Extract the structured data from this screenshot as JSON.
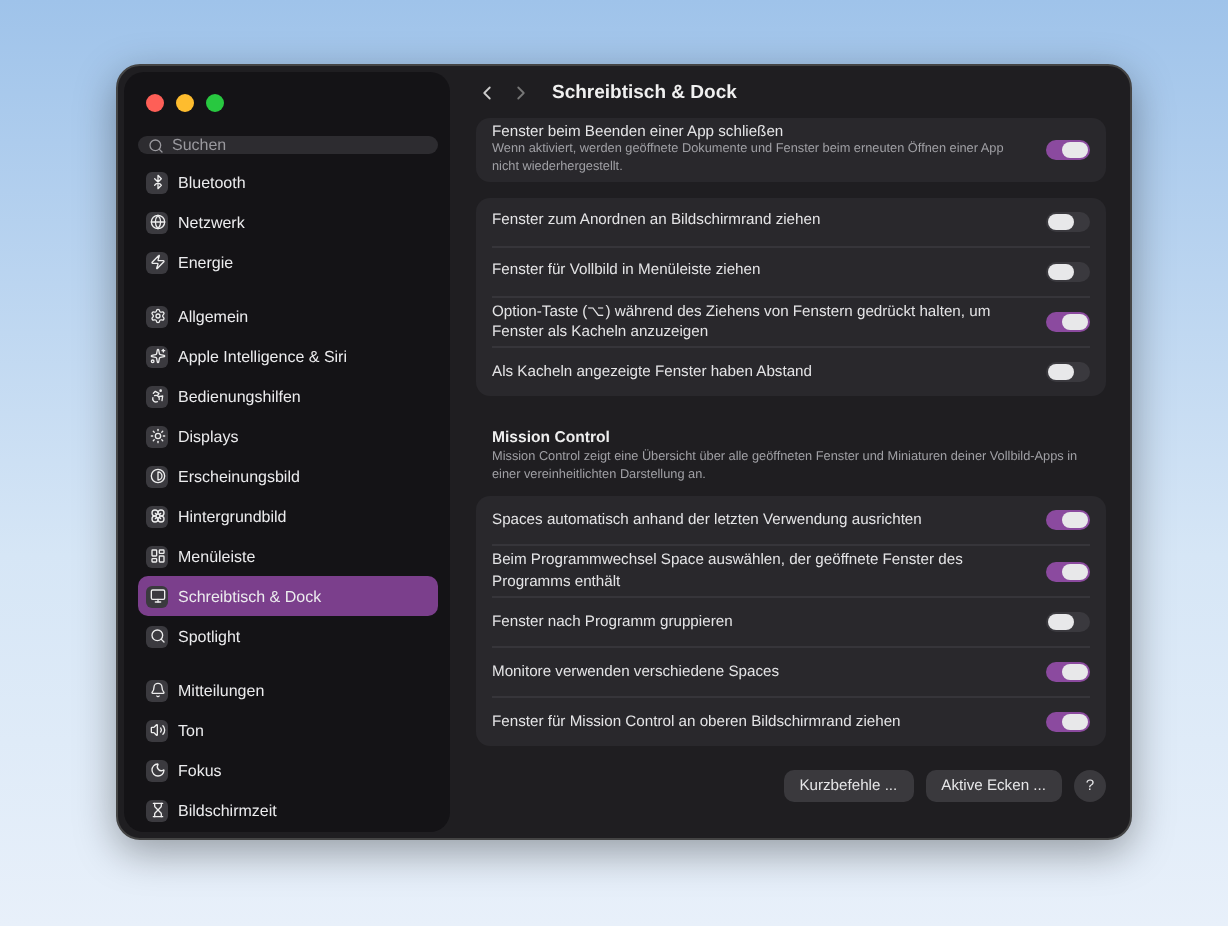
{
  "window": {
    "title": "Schreibtisch & Dock"
  },
  "sidebar": {
    "search": {
      "placeholder": "Suchen"
    },
    "groups": [
      [
        {
          "label": "Bluetooth",
          "selected": false
        },
        {
          "label": "Netzwerk",
          "selected": false
        },
        {
          "label": "Energie",
          "selected": false
        }
      ],
      [
        {
          "label": "Allgemein",
          "selected": false
        },
        {
          "label": "Apple Intelligence & Siri",
          "selected": false
        },
        {
          "label": "Bedienungshilfen",
          "selected": false
        },
        {
          "label": "Displays",
          "selected": false
        },
        {
          "label": "Erscheinungsbild",
          "selected": false
        },
        {
          "label": "Hintergrundbild",
          "selected": false
        },
        {
          "label": "Menüleiste",
          "selected": false
        },
        {
          "label": "Schreibtisch & Dock",
          "selected": true
        },
        {
          "label": "Spotlight",
          "selected": false
        }
      ],
      [
        {
          "label": "Mitteilungen",
          "selected": false
        },
        {
          "label": "Ton",
          "selected": false
        },
        {
          "label": "Fokus",
          "selected": false
        },
        {
          "label": "Bildschirmzeit",
          "selected": false
        }
      ]
    ]
  },
  "sections": [
    {
      "rows": [
        {
          "label": "Fenster beim Beenden einer App schließen",
          "description": "Wenn aktiviert, werden geöffnete Dokumente und Fenster beim erneuten Öffnen einer App nicht wiederhergestellt.",
          "on": true
        }
      ]
    },
    {
      "rows": [
        {
          "label": "Fenster zum Anordnen an Bildschirmrand ziehen",
          "on": false
        },
        {
          "label": "Fenster für Vollbild in Menüleiste ziehen",
          "on": false
        },
        {
          "label": "Option-Taste (⌥) während des Ziehens von Fenstern gedrückt halten, um Fenster als Kacheln anzuzeigen",
          "on": true
        },
        {
          "label": "Als Kacheln angezeigte Fenster haben Abstand",
          "on": false
        }
      ]
    },
    {
      "title": "Mission Control",
      "description": "Mission Control zeigt eine Übersicht über alle geöffneten Fenster und Miniaturen deiner Vollbild-Apps in einer vereinheitlichten Darstellung an.",
      "rows": [
        {
          "label": "Spaces automatisch anhand der letzten Verwendung ausrichten",
          "on": true
        },
        {
          "label": "Beim Programmwechsel Space auswählen, der geöffnete Fenster des Programms enthält",
          "on": true
        },
        {
          "label": "Fenster nach Programm gruppieren",
          "on": false
        },
        {
          "label": "Monitore verwenden verschiedene Spaces",
          "on": true
        },
        {
          "label": "Fenster für Mission Control an oberen Bildschirmrand ziehen",
          "on": true
        }
      ]
    }
  ],
  "buttons": [
    {
      "label": "Kurzbefehle ..."
    },
    {
      "label": "Aktive Ecken ..."
    },
    {
      "label": "?"
    }
  ]
}
